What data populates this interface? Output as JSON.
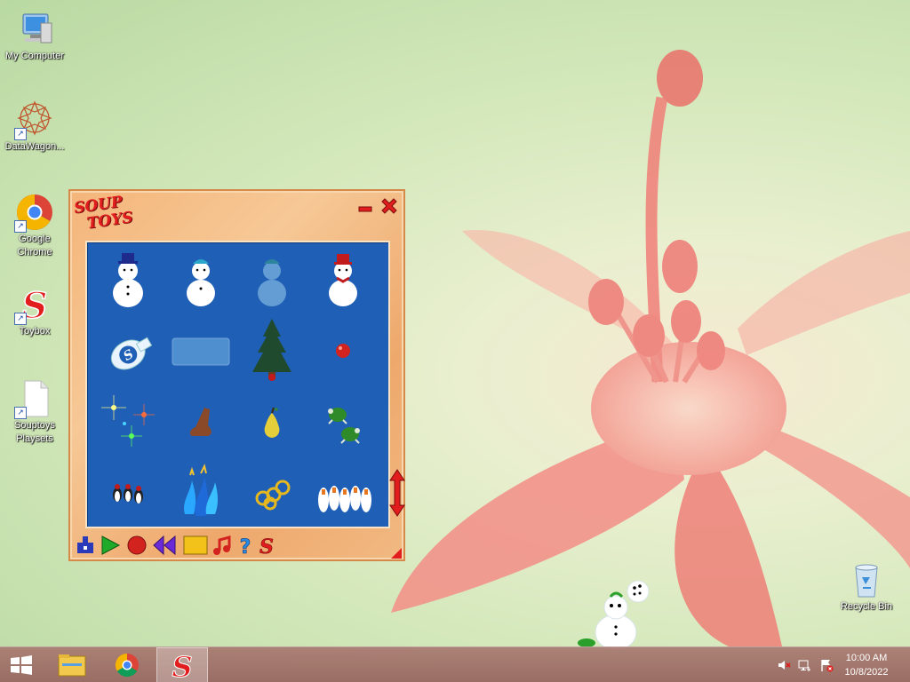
{
  "desktop": {
    "icons": [
      {
        "label": "My Computer",
        "icon": "computer-icon"
      },
      {
        "label": "DataWagon...",
        "icon": "datawagon-icon"
      },
      {
        "label": "Google\nChrome",
        "icon": "chrome-icon"
      },
      {
        "label": "Toybox",
        "icon": "toybox-icon"
      },
      {
        "label": "Souptoys\nPlaysets",
        "icon": "file-icon"
      },
      {
        "label": "Recycle Bin",
        "icon": "recycle-bin-icon"
      }
    ]
  },
  "toywindow": {
    "logo_line1": "SOUP",
    "logo_line2": "TOYS",
    "items": [
      {
        "name": "snowman-blue-hat"
      },
      {
        "name": "snowman-blue-cap"
      },
      {
        "name": "snowman-ghost"
      },
      {
        "name": "snowman-red-hat"
      },
      {
        "name": "soup-bottle"
      },
      {
        "name": "glass-pane"
      },
      {
        "name": "christmas-tree"
      },
      {
        "name": "red-ornament"
      },
      {
        "name": "sparkles"
      },
      {
        "name": "brown-boot"
      },
      {
        "name": "pear"
      },
      {
        "name": "turtles"
      },
      {
        "name": "penguins"
      },
      {
        "name": "blue-flames"
      },
      {
        "name": "gold-rings"
      },
      {
        "name": "geese"
      }
    ],
    "toolbar": [
      "stamp-icon",
      "play-icon",
      "record-icon",
      "rewind-icon",
      "stop-icon",
      "music-icon",
      "help-icon",
      "soup-s-icon"
    ]
  },
  "taskbar": {
    "buttons": [
      "start-icon",
      "file-explorer-icon",
      "chrome-icon",
      "toybox-icon"
    ],
    "time": "10:00 AM",
    "date": "10/8/2022"
  },
  "colors": {
    "tray_blue": "#1f5fb6",
    "frame_orange": "#f4b57a",
    "brand_red": "#e21d1d"
  }
}
